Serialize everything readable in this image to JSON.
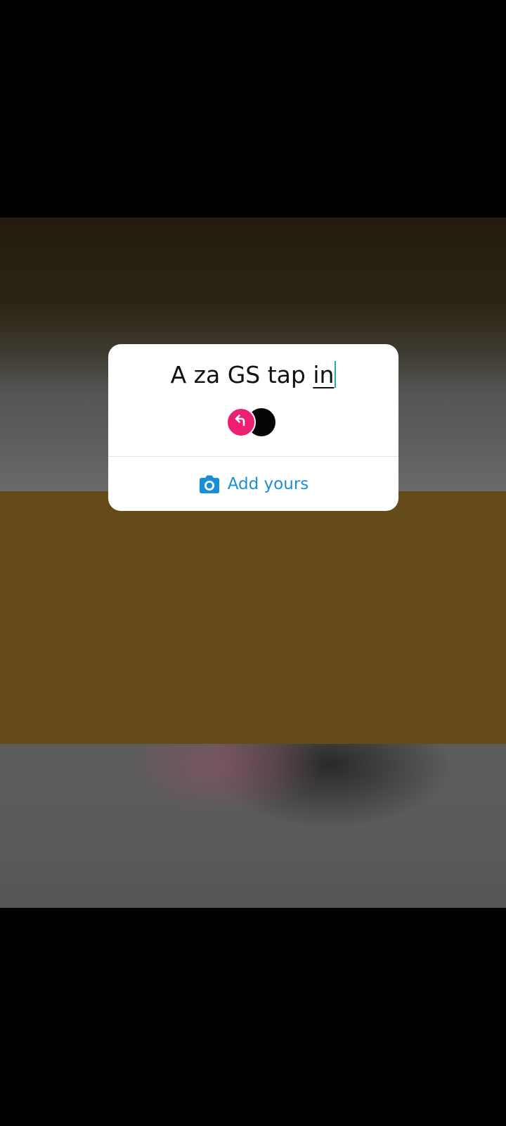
{
  "story": {
    "sticker": {
      "prompt_text": "A za GS tap ",
      "prompt_active_word": "in",
      "action_label": "Add yours"
    },
    "icons": {
      "reply": "reply-arrow-icon",
      "camera": "camera-icon"
    },
    "colors": {
      "band": "#644b18",
      "reply_badge": "#ec1f72",
      "accent": "#1a8fd8",
      "caret": "#27a6c9"
    }
  }
}
